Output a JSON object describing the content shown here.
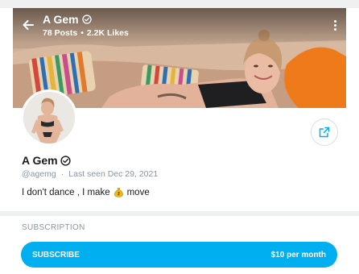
{
  "header": {
    "name": "A Gem",
    "posts": "78 Posts",
    "likes": "2.2K Likes",
    "separator": "•"
  },
  "profile": {
    "name": "A Gem",
    "handle": "@agemg",
    "separator": "·",
    "last_seen": "Last seen Dec 29, 2021",
    "bio_before": "I don't dance , I make",
    "bio_after": "move"
  },
  "subscription": {
    "title": "SUBSCRIPTION",
    "button_label": "SUBSCRIBE",
    "price": "$10 per month"
  },
  "colors": {
    "accent": "#00aff0",
    "muted_text": "#8a96a3",
    "divider": "#eef0f2"
  },
  "icons": {
    "back": "arrow-left-icon",
    "verified": "verified-badge-icon",
    "more": "more-vertical-icon",
    "share": "share-icon",
    "money_bag": "money-bag-icon"
  }
}
